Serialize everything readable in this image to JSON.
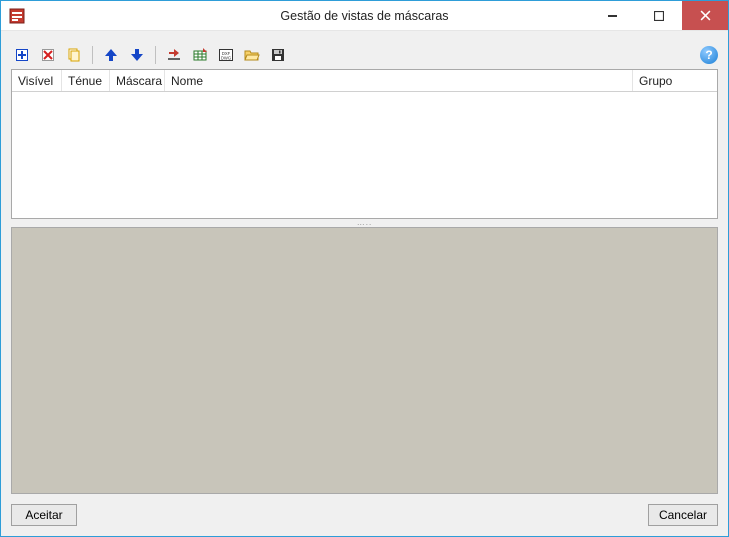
{
  "window": {
    "title": "Gestão de vistas de máscaras"
  },
  "toolbar": {
    "help_glyph": "?"
  },
  "table": {
    "columns": {
      "visivel": "Visível",
      "tenue": "Ténue",
      "mascara": "Máscara",
      "nome": "Nome",
      "grupo": "Grupo"
    }
  },
  "buttons": {
    "accept": "Aceitar",
    "cancel": "Cancelar"
  },
  "splitter_dots": "….."
}
